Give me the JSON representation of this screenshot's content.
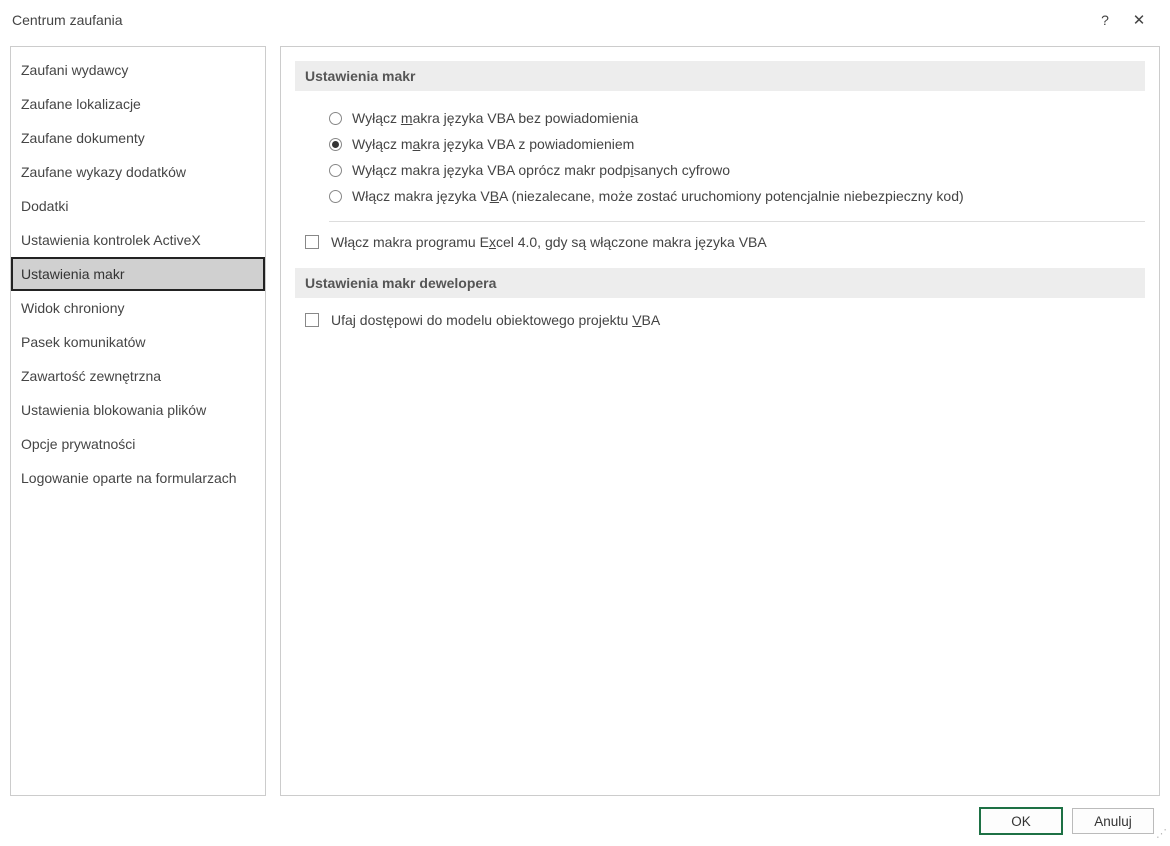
{
  "title": "Centrum zaufania",
  "sidebar": {
    "items": [
      {
        "label": "Zaufani wydawcy",
        "selected": false
      },
      {
        "label": "Zaufane lokalizacje",
        "selected": false
      },
      {
        "label": "Zaufane dokumenty",
        "selected": false
      },
      {
        "label": "Zaufane wykazy dodatków",
        "selected": false
      },
      {
        "label": "Dodatki",
        "selected": false
      },
      {
        "label": "Ustawienia kontrolek ActiveX",
        "selected": false
      },
      {
        "label": "Ustawienia makr",
        "selected": true
      },
      {
        "label": "Widok chroniony",
        "selected": false
      },
      {
        "label": "Pasek komunikatów",
        "selected": false
      },
      {
        "label": "Zawartość zewnętrzna",
        "selected": false
      },
      {
        "label": "Ustawienia blokowania plików",
        "selected": false
      },
      {
        "label": "Opcje prywatności",
        "selected": false
      },
      {
        "label": "Logowanie oparte na formularzach",
        "selected": false
      }
    ]
  },
  "sections": {
    "macro_settings_header": "Ustawienia makr",
    "developer_settings_header": "Ustawienia makr dewelopera"
  },
  "radios": {
    "selected_index": 1,
    "options": [
      {
        "pre": "Wyłącz ",
        "ul": "m",
        "post": "akra języka VBA bez powiadomienia"
      },
      {
        "pre": "Wyłącz m",
        "ul": "a",
        "post": "kra języka VBA z powiadomieniem"
      },
      {
        "pre": "Wyłącz makra języka VBA oprócz makr podp",
        "ul": "i",
        "post": "sanych cyfrowo"
      },
      {
        "pre": "Włącz makra języka V",
        "ul": "B",
        "post": "A (niezalecane, może zostać uruchomiony potencjalnie niebezpieczny kod)"
      }
    ]
  },
  "checkboxes": {
    "excel4": {
      "pre": "Włącz makra programu E",
      "ul": "x",
      "post": "cel 4.0, gdy są włączone makra języka VBA",
      "checked": false
    },
    "trust_vba": {
      "pre": "Ufaj dostępowi do modelu obiektowego projektu ",
      "ul": "V",
      "post": "BA",
      "checked": false
    }
  },
  "buttons": {
    "ok": "OK",
    "cancel": "Anuluj"
  }
}
